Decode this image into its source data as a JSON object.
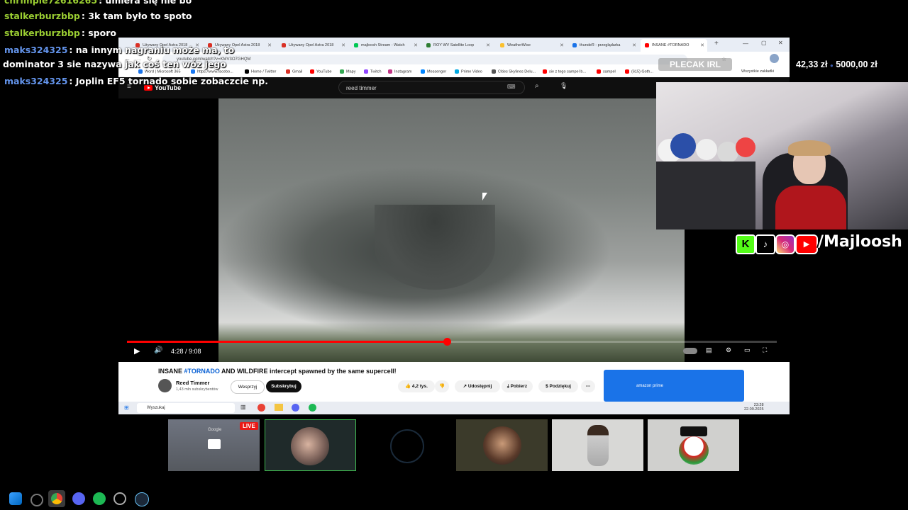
{
  "chat": [
    {
      "user": "chrimpie72616265",
      "text": ": umiera się nie bo",
      "color": "#9acd32"
    },
    {
      "user": "stalkerburzbbp",
      "text": ": 3k tam było to spoto",
      "color": "#9acd32"
    },
    {
      "user": "stalkerburzbbp",
      "text": ": sporo",
      "color": "#9acd32"
    },
    {
      "user": "maks324325",
      "text": ": na innym nagraniu może ma, to",
      "color": "#6495ed"
    },
    {
      "user": "",
      "text": "dominator 3 sie nazywa jak coś ten wóz jego",
      "color": "#ffffff"
    },
    {
      "user": "maks324325",
      "text": ": Joplin EF5 tornado sobie zobaczcie np.",
      "color": "#6495ed"
    }
  ],
  "overlay": {
    "plecak_label": "PLECAK IRL",
    "donation_current": "42,33 zł",
    "donation_goal": "5000,00 zł",
    "socials_handle": "/Majloosh"
  },
  "browser": {
    "tabs": [
      {
        "label": "Używany Opel Astra 2018",
        "icon_color": "#d93025"
      },
      {
        "label": "Używany Opel Astra 2018",
        "icon_color": "#d93025"
      },
      {
        "label": "Używany Opel Astra 2018",
        "icon_color": "#d93025"
      },
      {
        "label": "majloosh Stream - Watch",
        "icon_color": "#00c853"
      },
      {
        "label": "ROY WV Satellite Loop",
        "icon_color": "#2e7d32"
      },
      {
        "label": "WeatherWise",
        "icon_color": "#fbc02d"
      },
      {
        "label": "thundeR - przeglądarka",
        "icon_color": "#1a73e8"
      },
      {
        "label": "INSANE #TORNADO",
        "icon_color": "#ff0000"
      }
    ],
    "url": "youtube.com/watch?v=KMV3O7GHQM",
    "bookmarks": [
      {
        "label": "Word | Microsoft 365",
        "color": "#1a73e8"
      },
      {
        "label": "https://www.facebo...",
        "color": "#1877f2"
      },
      {
        "label": "Home / Twitter",
        "color": "#000000"
      },
      {
        "label": "Gmail",
        "color": "#d93025"
      },
      {
        "label": "YouTube",
        "color": "#ff0000"
      },
      {
        "label": "Mapy",
        "color": "#34a853"
      },
      {
        "label": "Twitch",
        "color": "#9146ff"
      },
      {
        "label": "Instagram",
        "color": "#c13584"
      },
      {
        "label": "Messenger",
        "color": "#0084ff"
      },
      {
        "label": "Prime Video",
        "color": "#00a8e1"
      },
      {
        "label": "Cities Skylines Delu...",
        "color": "#555555"
      },
      {
        "label": "sie z tego sampel b...",
        "color": "#ff0000"
      },
      {
        "label": "sampel",
        "color": "#ff0000"
      },
      {
        "label": "(615) Goth...",
        "color": "#ff0000"
      }
    ],
    "all_bookmarks": "Wszystkie zakładki"
  },
  "youtube": {
    "logo_text": "YouTube",
    "search_value": "reed timmer",
    "time_display": "4:28 / 9:08",
    "progress": 0.492,
    "video_title_prefix": "INSANE ",
    "video_title_tag": "#TORNADO",
    "video_title_suffix": " AND WILDFIRE intercept spawned by the same supercell!",
    "channel_name": "Reed Timmer",
    "channel_subs": "1,43 mln subskrybentów",
    "join_label": "Wesprzyj",
    "subscribe_label": "Subskrybuj",
    "likes": "4,2 tys.",
    "share_label": "Udostępnij",
    "download_label": "Pobierz",
    "thanks_label": "Podziękuj",
    "ad_brand": "amazon prime"
  },
  "inner_taskbar": {
    "search_placeholder": "Wyszukaj",
    "time": "23:28",
    "date": "22.09.2025"
  },
  "tiles": {
    "live_badge": "LIVE",
    "google_label": "Google"
  },
  "colors": {
    "youtube_red": "#ff0000",
    "chat_green": "#9acd32",
    "chat_blue": "#6495ed"
  }
}
